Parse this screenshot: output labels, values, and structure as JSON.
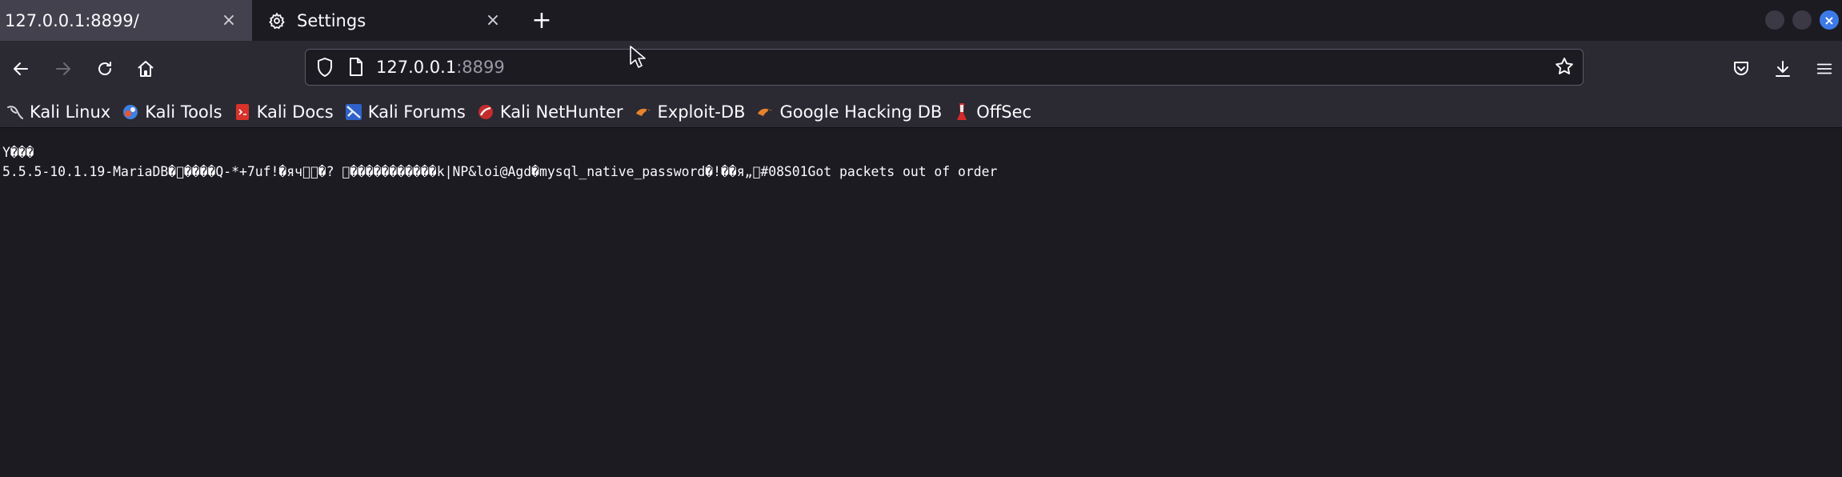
{
  "tabs": [
    {
      "label": "127.0.0.1:8899/",
      "close": "×",
      "active": true
    },
    {
      "label": "Settings",
      "close": "×",
      "icon": "gear-icon",
      "active": false
    }
  ],
  "new_tab": "+",
  "window_controls": {
    "close": "×"
  },
  "urlbar": {
    "host": "127.0.0.1",
    "port": ":8899"
  },
  "bookmarks": [
    {
      "label": "Kali Linux",
      "icon": "kali-dragon-icon"
    },
    {
      "label": "Kali Tools",
      "icon": "kali-tools-icon"
    },
    {
      "label": "Kali Docs",
      "icon": "kali-docs-icon"
    },
    {
      "label": "Kali Forums",
      "icon": "kali-forums-icon"
    },
    {
      "label": "Kali NetHunter",
      "icon": "nethunter-icon"
    },
    {
      "label": "Exploit-DB",
      "icon": "exploit-db-icon"
    },
    {
      "label": "Google Hacking DB",
      "icon": "ghdb-icon"
    },
    {
      "label": "OffSec",
      "icon": "offsec-icon"
    }
  ],
  "content": {
    "line1": "Y���",
    "line2": "5.5.5-10.1.19-MariaDB�\u0000����Q-*+7uf!�яч\u0000\u0000�? \u0015�����������k|NP&loi@Agd�mysql_native_password�!��\u0004я„\u0000#08S01Got packets out of order"
  },
  "colors": {
    "accent": "#3d7ae8",
    "tab_active": "#42414d",
    "toolbar": "#2b2a33",
    "page_bg": "#1c1b22"
  }
}
